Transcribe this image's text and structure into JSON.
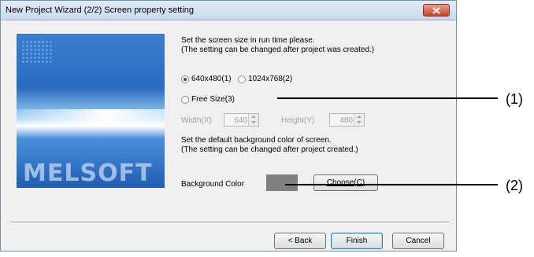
{
  "window": {
    "title": "New Project Wizard (2/2) Screen property setting"
  },
  "banner": {
    "logo_text": "MELSOFT"
  },
  "screen_size": {
    "description_line1": "Set the screen size in run time please.",
    "description_line2": "(The setting can be changed after project was created.)",
    "options": [
      {
        "label": "640x480(1)",
        "selected": true
      },
      {
        "label": "1024x768(2)",
        "selected": false
      },
      {
        "label": "Free Size(3)",
        "selected": false
      }
    ],
    "width_label": "Width(X)",
    "width_value": "640",
    "height_label": "Height(Y)",
    "height_value": "480"
  },
  "background": {
    "description_line1": "Set the default background color of screen.",
    "description_line2": "(The setting can be changed after project created.)",
    "color_label": "Background Color",
    "color_value": "#808080",
    "choose_label": "Choose(C)"
  },
  "buttons": {
    "back": "< Back",
    "finish": "Finish",
    "cancel": "Cancel"
  },
  "callouts": [
    "(1)",
    "(2)"
  ]
}
